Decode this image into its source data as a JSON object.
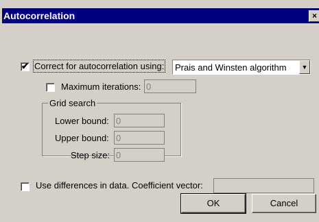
{
  "window": {
    "title": "Autocorrelation",
    "close_glyph": "×"
  },
  "correct": {
    "checked": true,
    "check_glyph": "✔",
    "label": "Correct for autocorrelation using:",
    "method": "Prais and Winsten algorithm",
    "method_arrow": "▼"
  },
  "max_iter": {
    "checked": false,
    "label": "Maximum iterations:",
    "value": "0"
  },
  "grid": {
    "caption": "Grid search",
    "lower_label": "Lower bound:",
    "lower_value": "0",
    "upper_label": "Upper bound:",
    "upper_value": "0",
    "step_label": "Step size:",
    "step_value": "0"
  },
  "differences": {
    "checked": false,
    "label": "Use differences in data. Coefficient vector:",
    "value": ""
  },
  "buttons": {
    "ok": "OK",
    "cancel": "Cancel"
  },
  "colors": {
    "titlebar": "#000080",
    "face": "#d4d0c8"
  }
}
